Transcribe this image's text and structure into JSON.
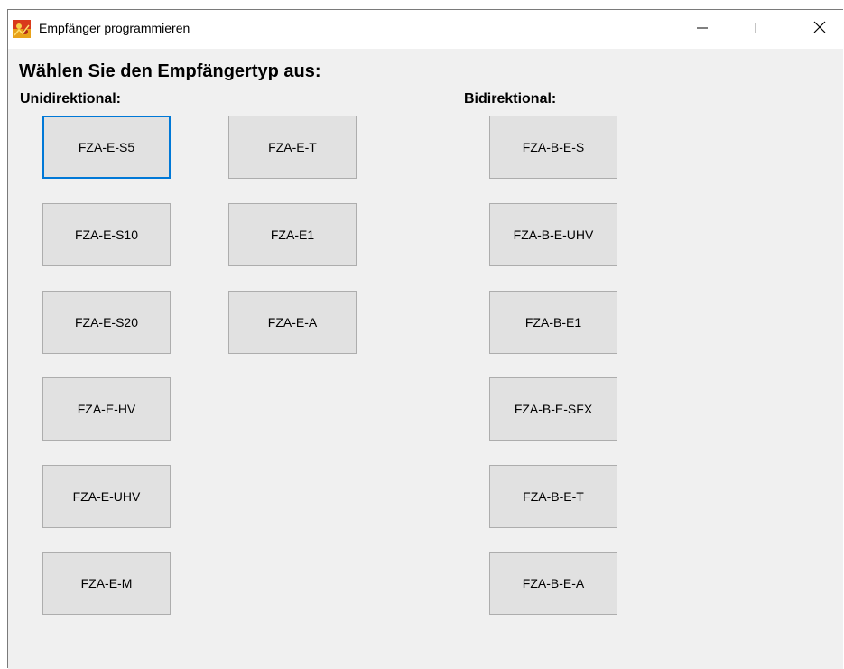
{
  "window": {
    "title": "Empfänger programmieren"
  },
  "heading": "Wählen Sie den Empfängertyp aus:",
  "sections": {
    "unidirectional_label": "Unidirektional:",
    "bidirectional_label": "Bidirektional:"
  },
  "buttons": {
    "uni_col1": [
      "FZA-E-S5",
      "FZA-E-S10",
      "FZA-E-S20",
      "FZA-E-HV",
      "FZA-E-UHV",
      "FZA-E-M"
    ],
    "uni_col2": [
      "FZA-E-T",
      "FZA-E1",
      "FZA-E-A"
    ],
    "bi": [
      "FZA-B-E-S",
      "FZA-B-E-UHV",
      "FZA-B-E1",
      "FZA-B-E-SFX",
      "FZA-B-E-T",
      "FZA-B-E-A"
    ]
  },
  "focused_button": "FZA-E-S5",
  "colors": {
    "focus_border": "#0078d7",
    "button_face": "#e1e1e1",
    "window_bg": "#f0f0f0"
  },
  "icons": {
    "app": "app-logo-icon",
    "minimize": "minimize-icon",
    "maximize": "maximize-icon",
    "close": "close-icon"
  }
}
